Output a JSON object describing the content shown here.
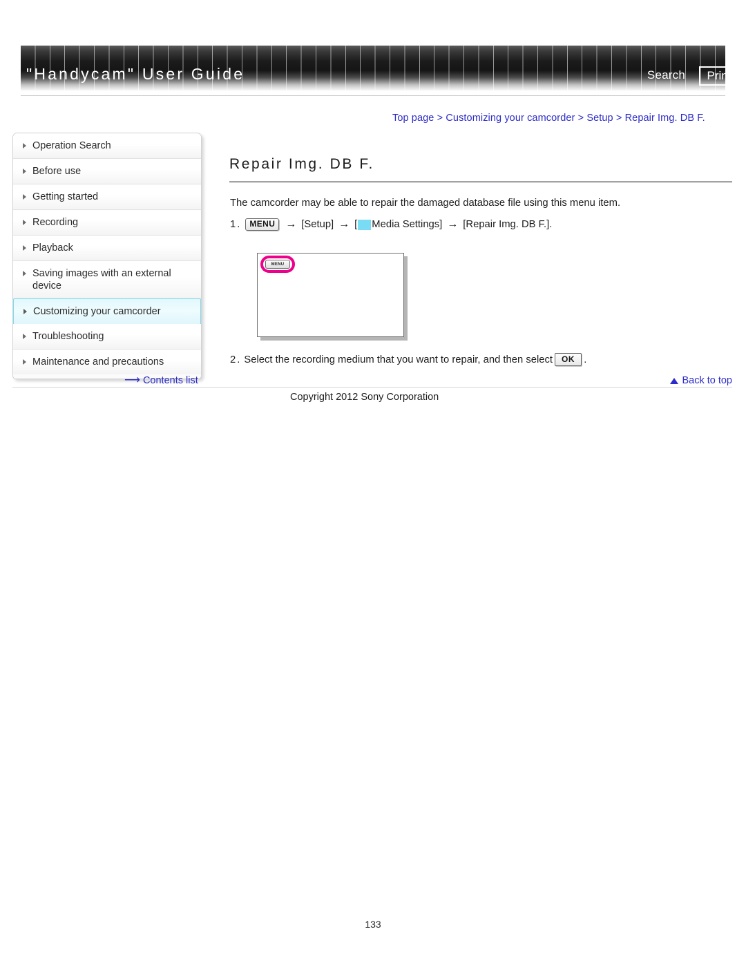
{
  "header": {
    "site_title": "\"Handycam\" User Guide",
    "search_label": "Search",
    "print_label": "Print"
  },
  "breadcrumb": {
    "separator": ">",
    "items": [
      "Top page",
      "Customizing your camcorder",
      "Setup",
      "Repair Img. DB F."
    ]
  },
  "sidebar": {
    "items": [
      {
        "label": "Operation Search",
        "active": false
      },
      {
        "label": "Before use",
        "active": false
      },
      {
        "label": "Getting started",
        "active": false
      },
      {
        "label": "Recording",
        "active": false
      },
      {
        "label": "Playback",
        "active": false
      },
      {
        "label": "Saving images with an external device",
        "active": false
      },
      {
        "label": "Customizing your camcorder",
        "active": true
      },
      {
        "label": "Troubleshooting",
        "active": false
      },
      {
        "label": "Maintenance and precautions",
        "active": false
      }
    ]
  },
  "main": {
    "heading": "Repair Img. DB F.",
    "intro": "The camcorder may be able to repair the damaged database file using this menu item.",
    "step1": {
      "number": "1.",
      "menu_chip": "MENU",
      "arrow": "→",
      "part_setup": "[Setup]",
      "part_media_open": "[",
      "part_media": "Media Settings]",
      "part_repair": "[Repair Img. DB F.].",
      "cyan_color": "#79dcf4"
    },
    "figure": {
      "menu_chip": "MENU",
      "highlight_color": "#ec008c"
    },
    "step2": {
      "number": "2.",
      "text_before": "Select the recording medium that you want to repair, and then select",
      "ok_chip": "OK",
      "text_after": "."
    }
  },
  "footer": {
    "contents_list": "Contents list",
    "contents_arrow": "⟶",
    "back_to_top": "Back to top",
    "copyright": "Copyright 2012 Sony Corporation",
    "page_number": "133"
  }
}
